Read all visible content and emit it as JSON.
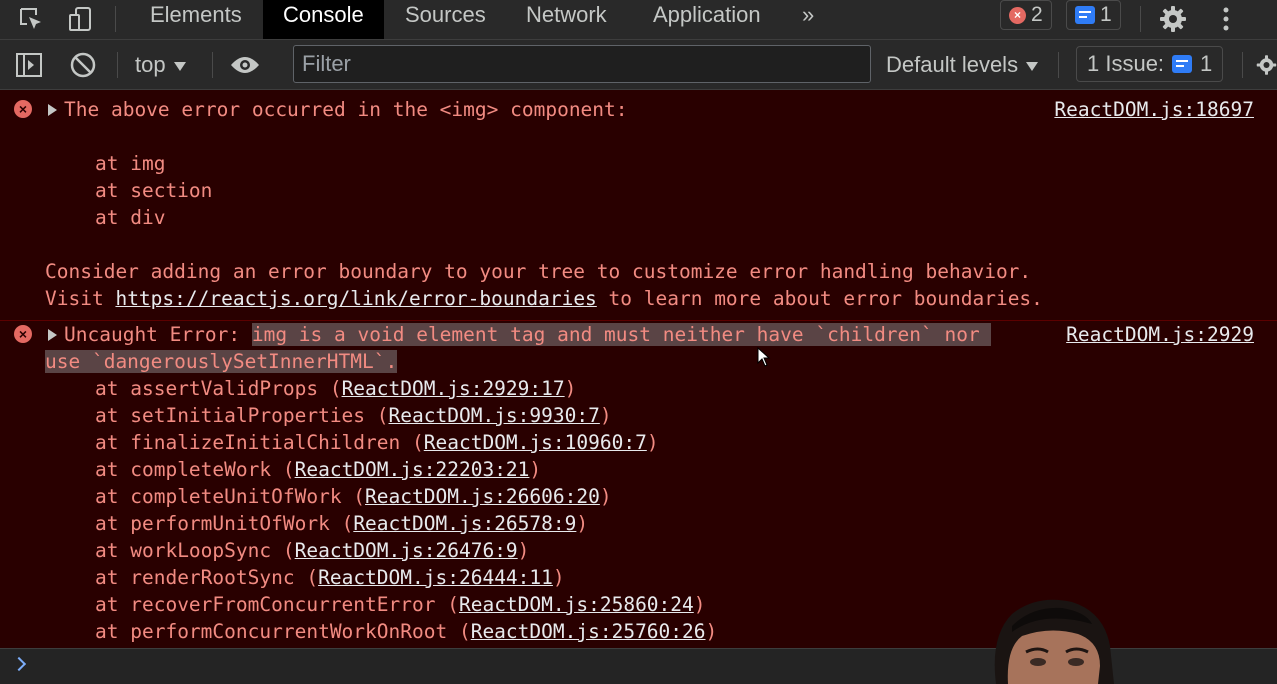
{
  "tabs": [
    "Elements",
    "Console",
    "Sources",
    "Network",
    "Application"
  ],
  "more_tabs_label": "»",
  "errors_count": "2",
  "messages_count": "1",
  "toolbar": {
    "context": "top",
    "filter_placeholder": "Filter",
    "levels": "Default levels",
    "issues_label": "1 Issue:",
    "issues_count": "1"
  },
  "entry1": {
    "message": "The above error occurred in the <img> component:",
    "source": "ReactDOM.js:18697",
    "stack": [
      "at img",
      "at section",
      "at div"
    ],
    "consider": "Consider adding an error boundary to your tree to customize error handling behavior.",
    "visit_prefix": "Visit ",
    "visit_link": "https://reactjs.org/link/error-boundaries",
    "visit_suffix": " to learn more about error boundaries."
  },
  "entry2": {
    "prefix": "Uncaught Error: ",
    "highlight1": "img is a void element tag and must neither have `children` nor ",
    "highlight2": "use `dangerouslySetInnerHTML`.",
    "source": "ReactDOM.js:2929",
    "stack": [
      {
        "fn": "assertValidProps",
        "loc": "ReactDOM.js:2929:17"
      },
      {
        "fn": "setInitialProperties",
        "loc": "ReactDOM.js:9930:7"
      },
      {
        "fn": "finalizeInitialChildren",
        "loc": "ReactDOM.js:10960:7"
      },
      {
        "fn": "completeWork",
        "loc": "ReactDOM.js:22203:21"
      },
      {
        "fn": "completeUnitOfWork",
        "loc": "ReactDOM.js:26606:20"
      },
      {
        "fn": "performUnitOfWork",
        "loc": "ReactDOM.js:26578:9"
      },
      {
        "fn": "workLoopSync",
        "loc": "ReactDOM.js:26476:9"
      },
      {
        "fn": "renderRootSync",
        "loc": "ReactDOM.js:26444:11"
      },
      {
        "fn": "recoverFromConcurrentError",
        "loc": "ReactDOM.js:25860:24"
      },
      {
        "fn": "performConcurrentWorkOnRoot",
        "loc": "ReactDOM.js:25760:26"
      }
    ]
  },
  "colors": {
    "error_bg": "#290000",
    "error_text": "#f28b82",
    "accent": "#7cacf8"
  }
}
